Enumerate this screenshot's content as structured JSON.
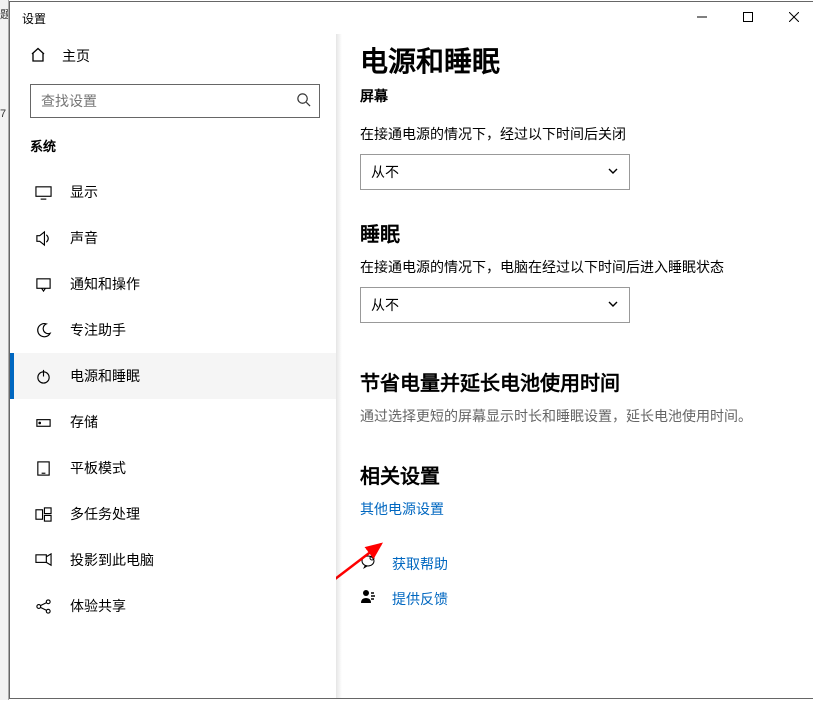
{
  "window": {
    "title": "设置"
  },
  "sidebar": {
    "home_label": "主页",
    "search_placeholder": "查找设置",
    "section_title": "系统",
    "items": [
      {
        "label": "显示"
      },
      {
        "label": "声音"
      },
      {
        "label": "通知和操作"
      },
      {
        "label": "专注助手"
      },
      {
        "label": "电源和睡眠"
      },
      {
        "label": "存储"
      },
      {
        "label": "平板模式"
      },
      {
        "label": "多任务处理"
      },
      {
        "label": "投影到此电脑"
      },
      {
        "label": "体验共享"
      }
    ],
    "selected_index": 4
  },
  "main": {
    "title": "电源和睡眠",
    "screen": {
      "heading": "屏幕",
      "desc": "在接通电源的情况下，经过以下时间后关闭",
      "value": "从不"
    },
    "sleep": {
      "heading": "睡眠",
      "desc": "在接通电源的情况下，电脑在经过以下时间后进入睡眠状态",
      "value": "从不"
    },
    "battery": {
      "heading": "节省电量并延长电池使用时间",
      "desc": "通过选择更短的屏幕显示时长和睡眠设置，延长电池使用时间。"
    },
    "related": {
      "heading": "相关设置",
      "link": "其他电源设置"
    },
    "help": {
      "get_help": "获取帮助",
      "feedback": "提供反馈"
    }
  },
  "leftedge": {
    "line1": "题",
    "line2": "7"
  }
}
